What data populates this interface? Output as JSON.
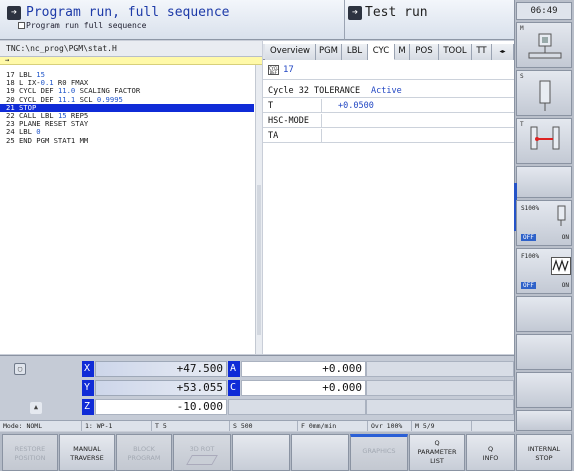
{
  "header": {
    "left_title": "Program run, full sequence",
    "left_subtitle": "Program run full sequence",
    "right_title": "Test run",
    "clock": "06:49"
  },
  "program": {
    "path": "TNC:\\nc_prog\\PGM\\stat.H",
    "arrow": "→",
    "lines": [
      {
        "pre": "17 LBL ",
        "num": "15",
        "post": ""
      },
      {
        "pre": "18 L IX-",
        "num": "0.1",
        "post": " R0 FMAX"
      },
      {
        "pre": "19 CYCL DEF ",
        "num": "11.0",
        "post": " SCALING FACTOR"
      },
      {
        "pre": "20 CYCL DEF ",
        "num": "11.1",
        "post": " SCL ",
        "num2": "0.9995"
      },
      {
        "pre": "21 STOP",
        "num": "",
        "post": ""
      },
      {
        "pre": "22 CALL LBL ",
        "num": "15",
        "post": " REP5"
      },
      {
        "pre": "23 PLANE RESET STAY",
        "num": "",
        "post": ""
      },
      {
        "pre": "24 LBL ",
        "num": "0",
        "post": ""
      },
      {
        "pre": "25 END PGM STAT1 MM",
        "num": "",
        "post": ""
      }
    ],
    "current_line_index": 4
  },
  "status": {
    "tabs": [
      "Overview",
      "PGM",
      "LBL",
      "CYC",
      "M",
      "POS",
      "TOOL",
      "TT"
    ],
    "active_tab": "CYC",
    "tab_more": "◂▸",
    "cycle_icon_text": "CYCL DEF",
    "cycle_number": "17",
    "rows": [
      {
        "key": "Cycle 32 TOLERANCE",
        "value": "Active"
      },
      {
        "key": "T",
        "value": "+0.0500"
      },
      {
        "key": "HSC-MODE",
        "value": ""
      },
      {
        "key": "TA",
        "value": ""
      }
    ]
  },
  "positions": [
    {
      "axis": "X",
      "value": "+47.500",
      "axis2": "A",
      "value2": "+0.000"
    },
    {
      "axis": "Y",
      "value": "+53.055",
      "axis2": "C",
      "value2": "+0.000"
    },
    {
      "axis": "Z",
      "value": "-10.000"
    }
  ],
  "modebar": {
    "mode": "Mode: NOML",
    "wp": "1: WP-1",
    "tool": "T 5",
    "spindle": "S 500",
    "feed": "F 0mm/min",
    "ovr": "Ovr 100%",
    "m": "M 5/9"
  },
  "side_keys": {
    "m_label": "M",
    "s_label": "S",
    "t_label": "T",
    "s_override": "S100%",
    "f_override": "F100%",
    "off": "OFF",
    "on": "ON"
  },
  "bottom_keys": [
    {
      "line1": "RESTORE",
      "line2": "POSITION",
      "enabled": false
    },
    {
      "line1": "MANUAL",
      "line2": "TRAVERSE",
      "enabled": true
    },
    {
      "line1": "BLOCK",
      "line2": "PROGRAM",
      "enabled": false
    },
    {
      "line1": "3D ROT",
      "line2": "",
      "enabled": false
    },
    {
      "line1": "",
      "line2": "",
      "enabled": true
    },
    {
      "line1": "",
      "line2": "",
      "enabled": true
    },
    {
      "line1": "GRAPHICS",
      "line2": "",
      "enabled": false
    },
    {
      "line1": "Q",
      "line2": "PARAMETER",
      "line3": "LIST",
      "enabled": true
    },
    {
      "line1": "Q",
      "line2": "INFO",
      "enabled": true
    },
    {
      "line1": "INTERNAL",
      "line2": "STOP",
      "enabled": true
    }
  ]
}
